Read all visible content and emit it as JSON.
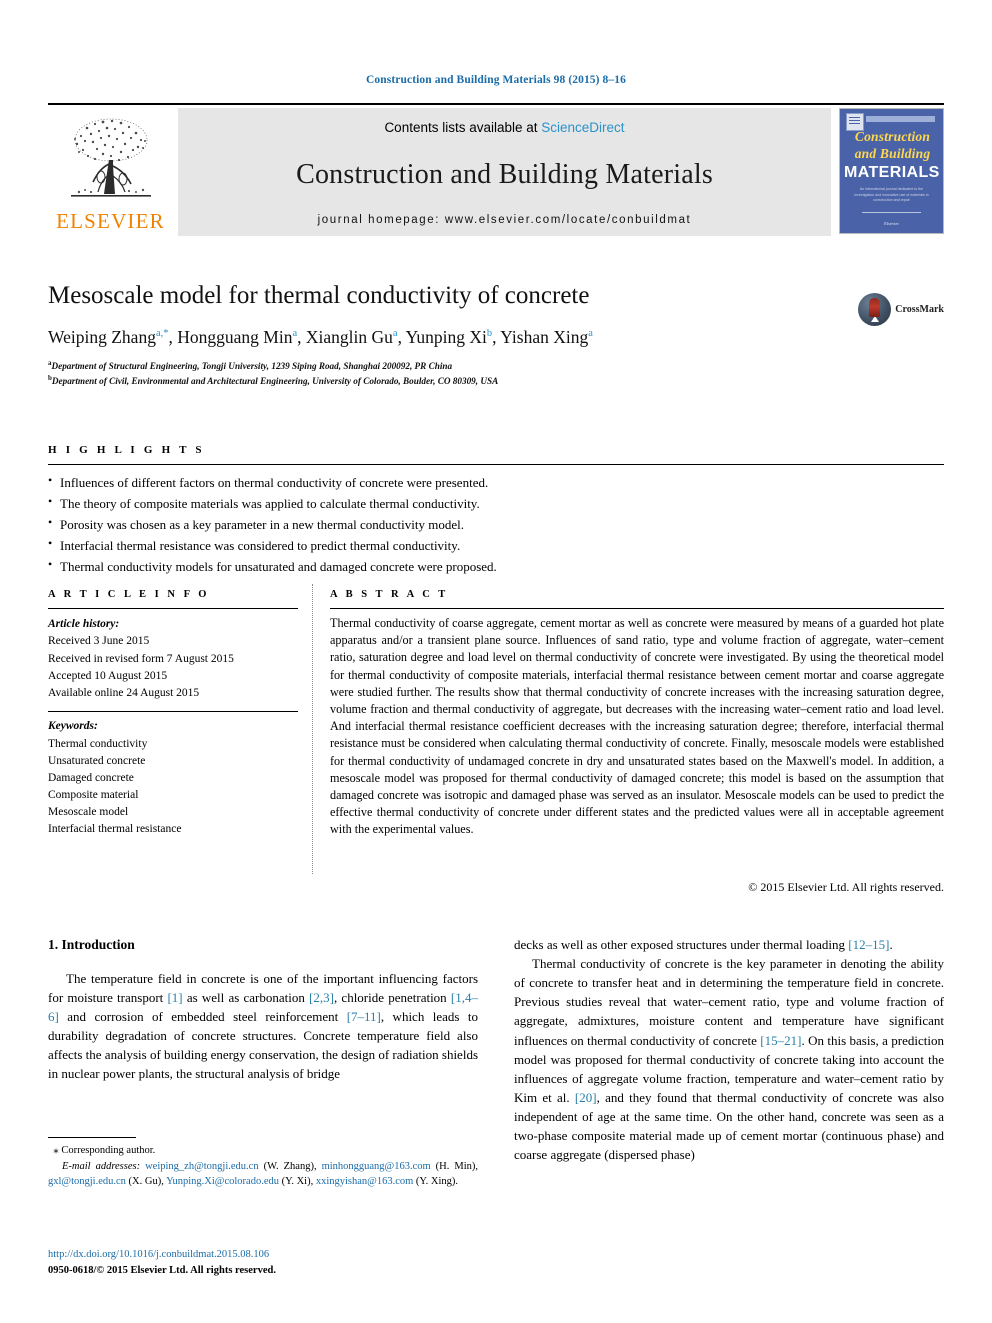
{
  "running_head": "Construction and Building Materials 98 (2015) 8–16",
  "masthead": {
    "publisher_logo_name": "elsevier-tree-logo",
    "publisher_wordmark": "ELSEVIER",
    "contents_prefix": "Contents lists available at ",
    "contents_link": "ScienceDirect",
    "journal_title": "Construction and Building Materials",
    "homepage_line": "journal homepage: www.elsevier.com/locate/conbuildmat",
    "cover": {
      "line1": "Construction",
      "line2": "and Building",
      "line3": "MATERIALS",
      "blurb": "An international journal dedicated to the investigation and innovative use of materials in construction and repair",
      "footer": "Elsevier"
    },
    "link_color": "#2a93c9",
    "band_color": "#e6e6e6",
    "elsevier_orange": "#ef8200"
  },
  "article": {
    "title": "Mesoscale model for thermal conductivity of concrete",
    "authors": [
      {
        "name": "Weiping Zhang",
        "marks": "a,*"
      },
      {
        "name": "Hongguang Min",
        "marks": "a"
      },
      {
        "name": "Xianglin Gu",
        "marks": "a"
      },
      {
        "name": "Yunping Xi",
        "marks": "b"
      },
      {
        "name": "Yishan Xing",
        "marks": "a"
      }
    ],
    "affiliations": [
      {
        "mark": "a",
        "text": "Department of Structural Engineering, Tongji University, 1239 Siping Road, Shanghai 200092, PR China"
      },
      {
        "mark": "b",
        "text": "Department of Civil, Environmental and Architectural Engineering, University of Colorado, Boulder, CO 80309, USA"
      }
    ],
    "crossmark_label": "CrossMark"
  },
  "highlights": {
    "heading": "H I G H L I G H T S",
    "items": [
      "Influences of different factors on thermal conductivity of concrete were presented.",
      "The theory of composite materials was applied to calculate thermal conductivity.",
      "Porosity was chosen as a key parameter in a new thermal conductivity model.",
      "Interfacial thermal resistance was considered to predict thermal conductivity.",
      "Thermal conductivity models for unsaturated and damaged concrete were proposed."
    ]
  },
  "article_info": {
    "heading": "A R T I C L E   I N F O",
    "history_label": "Article history:",
    "history": [
      "Received 3 June 2015",
      "Received in revised form 7 August 2015",
      "Accepted 10 August 2015",
      "Available online 24 August 2015"
    ],
    "keywords_label": "Keywords:",
    "keywords": [
      "Thermal conductivity",
      "Unsaturated concrete",
      "Damaged concrete",
      "Composite material",
      "Mesoscale model",
      "Interfacial thermal resistance"
    ]
  },
  "abstract": {
    "heading": "A B S T R A C T",
    "text": "Thermal conductivity of coarse aggregate, cement mortar as well as concrete were measured by means of a guarded hot plate apparatus and/or a transient plane source. Influences of sand ratio, type and volume fraction of aggregate, water–cement ratio, saturation degree and load level on thermal conductivity of concrete were investigated. By using the theoretical model for thermal conductivity of composite materials, interfacial thermal resistance between cement mortar and coarse aggregate were studied further. The results show that thermal conductivity of concrete increases with the increasing saturation degree, volume fraction and thermal conductivity of aggregate, but decreases with the increasing water–cement ratio and load level. And interfacial thermal resistance coefficient decreases with the increasing saturation degree; therefore, interfacial thermal resistance must be considered when calculating thermal conductivity of concrete. Finally, mesoscale models were established for thermal conductivity of undamaged concrete in dry and unsaturated states based on the Maxwell's model. In addition, a mesoscale model was proposed for thermal conductivity of damaged concrete; this model is based on the assumption that damaged concrete was isotropic and damaged phase was served as an insulator. Mesoscale models can be used to predict the effective thermal conductivity of concrete under different states and the predicted values were all in acceptable agreement with the experimental values.",
    "copyright": "© 2015 Elsevier Ltd. All rights reserved."
  },
  "body": {
    "section_number_title": "1. Introduction",
    "left_paragraph_html": "The temperature field in concrete is one of the important influencing factors for moisture transport <span class=\"ref\">[1]</span> as well as carbonation <span class=\"ref\">[2,3]</span>, chloride penetration <span class=\"ref\">[1,4–6]</span> and corrosion of embedded steel reinforcement <span class=\"ref\">[7–11]</span>, which leads to durability degradation of concrete structures. Concrete temperature field also affects the analysis of building energy conservation, the design of radiation shields in nuclear power plants, the structural analysis of bridge",
    "right_paragraph1_html": "decks as well as other exposed structures under thermal loading <span class=\"ref\">[12–15]</span>.",
    "right_paragraph2_html": "Thermal conductivity of concrete is the key parameter in denoting the ability of concrete to transfer heat and in determining the temperature field in concrete. Previous studies reveal that water–cement ratio, type and volume fraction of aggregate, admixtures, moisture content and temperature have significant influences on thermal conductivity of concrete <span class=\"ref\">[15–21]</span>. On this basis, a prediction model was proposed for thermal conductivity of concrete taking into account the influences of aggregate volume fraction, temperature and water–cement ratio by Kim et al. <span class=\"ref\">[20]</span>, and they found that thermal conductivity of concrete was also independent of age at the same time. On the other hand, concrete was seen as a two-phase composite material made up of cement mortar (continuous phase) and coarse aggregate (dispersed phase)",
    "reference_link_color": "#2a7fa8"
  },
  "footnote": {
    "corresponding_marker": "⁎",
    "corresponding_text": "Corresponding author.",
    "email_label": "E-mail addresses:",
    "emails_html": "<span class=\"mail\">weiping_zh@tongji.edu.cn</span> (W. Zhang), <span class=\"mail\">minhongguang@163.com</span> (H. Min), <span class=\"mail\">gxl@tongji.edu.cn</span> (X. Gu), <span class=\"mail\">Yunping.Xi@colorado.edu</span> (Y. Xi), <span class=\"mail\">xxingyishan@163.com</span> (Y. Xing).",
    "doi": "http://dx.doi.org/10.1016/j.conbuildmat.2015.08.106",
    "issn_line": "0950-0618/© 2015 Elsevier Ltd. All rights reserved."
  }
}
